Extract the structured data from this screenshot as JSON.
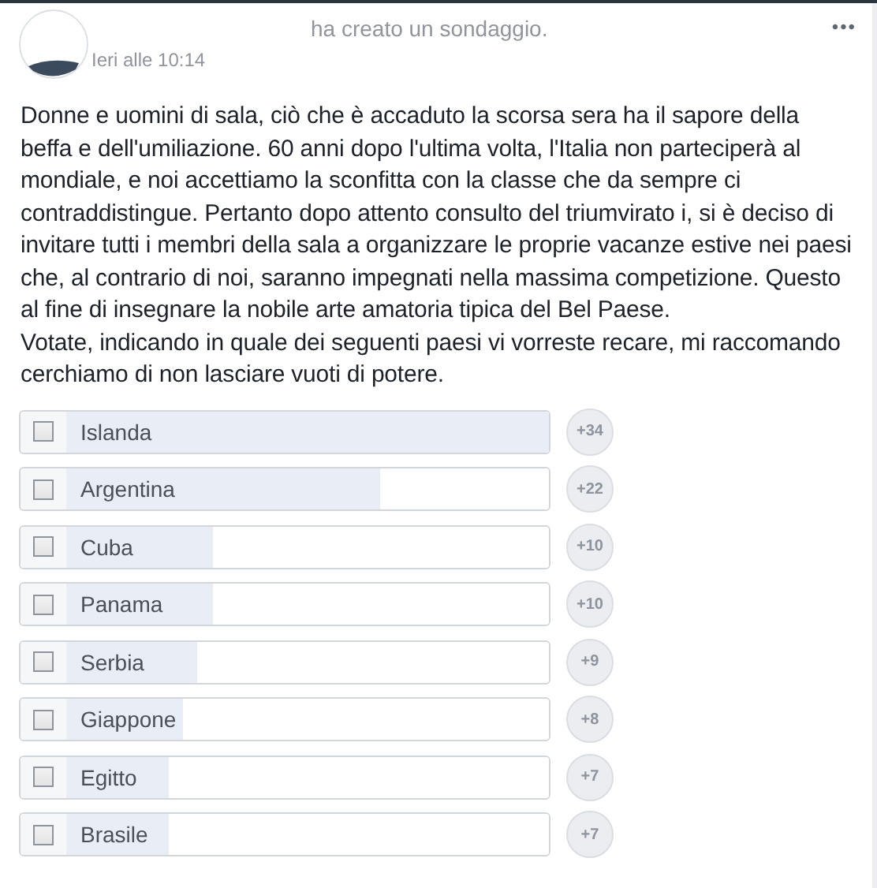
{
  "post": {
    "action": "ha creato un sondaggio.",
    "time": "Ieri alle 10:14",
    "menu": "•••",
    "text": "Donne e uomini di sala, ciò che è accaduto la scorsa sera ha il sapore della beffa e dell'umiliazione. 60 anni dopo l'ultima volta, l'Italia non parteciperà al mondiale, e noi accettiamo la sconfitta con la classe che da sempre ci contraddistingue. Pertanto dopo attento consulto del triumvirato i, si è deciso di invitare tutti i membri della sala a organizzare le proprie vacanze estive nei paesi che, al contrario di noi, saranno impegnati nella massima competizione. Questo al fine di insegnare la nobile arte amatoria tipica del Bel Paese.\nVotate, indicando in quale dei seguenti paesi vi vorreste recare, mi raccomando cerchiamo di non lasciare vuoti di potere."
  },
  "poll": {
    "options": [
      {
        "label": "Islanda",
        "checked": false,
        "level": 1,
        "votes": "+34"
      },
      {
        "label": "Argentina",
        "checked": false,
        "level": 0.65,
        "votes": "+22"
      },
      {
        "label": "Cuba",
        "checked": false,
        "level": 0.3,
        "votes": "+10"
      },
      {
        "label": "Panama",
        "checked": false,
        "level": 0.3,
        "votes": "+10"
      },
      {
        "label": "Serbia",
        "checked": false,
        "level": 0.27,
        "votes": "+9"
      },
      {
        "label": "Giappone",
        "checked": false,
        "level": 0.24,
        "votes": "+8"
      },
      {
        "label": "Egitto",
        "checked": false,
        "level": 0.21,
        "votes": "+7"
      },
      {
        "label": "Brasile",
        "checked": false,
        "level": 0.21,
        "votes": "+7"
      }
    ]
  }
}
